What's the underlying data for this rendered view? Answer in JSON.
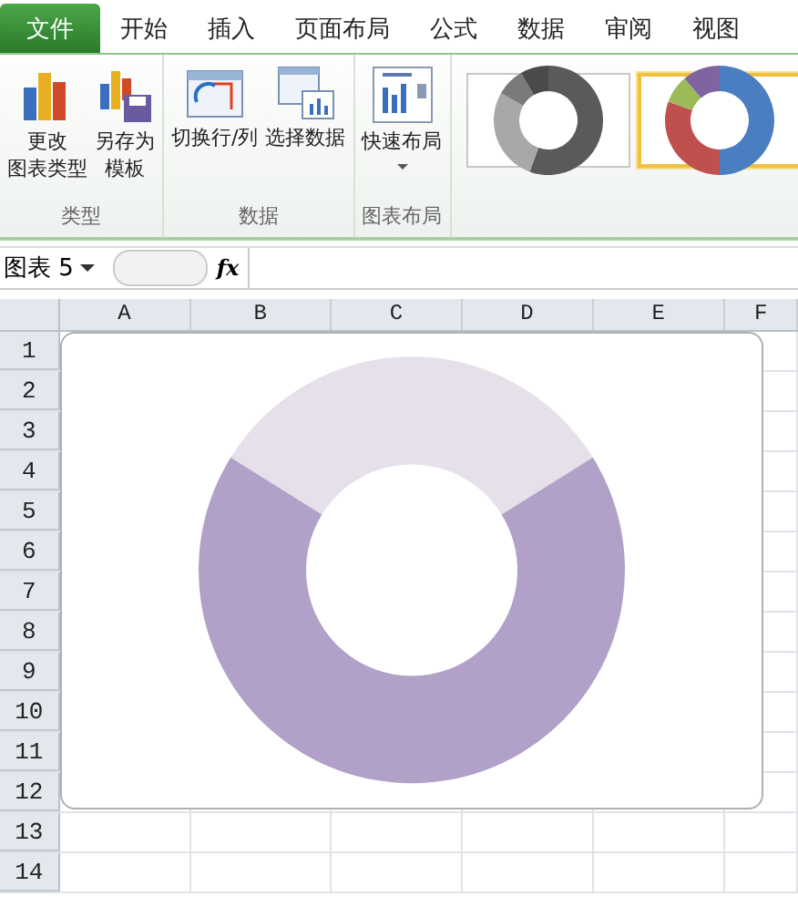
{
  "file_tab": {
    "label": "文件"
  },
  "tabs": [
    {
      "label": "开始",
      "selected": false
    },
    {
      "label": "插入",
      "selected": false
    },
    {
      "label": "页面布局",
      "selected": false
    },
    {
      "label": "公式",
      "selected": false
    },
    {
      "label": "数据",
      "selected": false
    },
    {
      "label": "审阅",
      "selected": false
    },
    {
      "label": "视图",
      "selected": false
    }
  ],
  "ribbon_groups": [
    {
      "label": "类型",
      "buttons": [
        {
          "kind": "change-type",
          "lines": [
            "更改",
            "图表类型"
          ]
        },
        {
          "kind": "save-template",
          "lines": [
            "另存为",
            "模板"
          ]
        }
      ]
    },
    {
      "label": "数据",
      "buttons": [
        {
          "kind": "switch",
          "lines": [
            "切换行/列"
          ]
        },
        {
          "kind": "select-data",
          "lines": [
            "选择数据"
          ]
        }
      ]
    },
    {
      "label": "图表布局",
      "buttons": [
        {
          "kind": "layout",
          "lines": [
            "快速布局"
          ],
          "dropdown": true
        }
      ]
    }
  ],
  "chart_styles": [
    {
      "kind": "gray",
      "selected": false
    },
    {
      "kind": "color",
      "selected": true
    }
  ],
  "name_box": {
    "value": "图表 5"
  },
  "formula_bar": {
    "fx": "fx"
  },
  "columns": [
    "A",
    "B",
    "C",
    "D",
    "E",
    "F"
  ],
  "rows": [
    "1",
    "2",
    "3",
    "4",
    "5",
    "6",
    "7",
    "8",
    "9",
    "10",
    "11",
    "12",
    "13",
    "14"
  ]
}
